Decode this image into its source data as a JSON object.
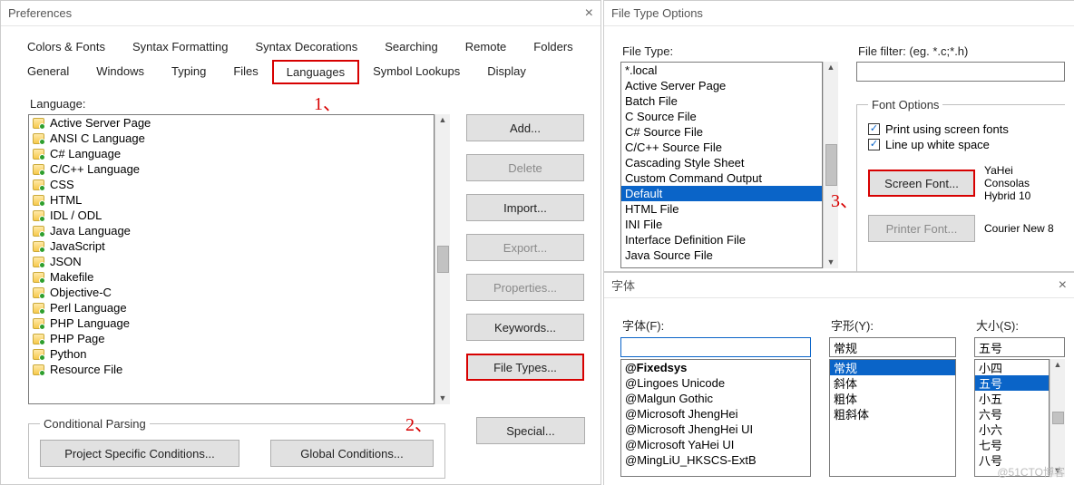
{
  "prefs": {
    "title": "Preferences",
    "tabs_row1": [
      "Colors & Fonts",
      "Syntax Formatting",
      "Syntax Decorations",
      "Searching",
      "Remote",
      "Folders"
    ],
    "tabs_row2": [
      "General",
      "Windows",
      "Typing",
      "Files",
      "Languages",
      "Symbol Lookups",
      "Display"
    ],
    "selected_tab": "Languages",
    "language_label": "Language:",
    "languages": [
      "Active Server Page",
      "ANSI C Language",
      "C# Language",
      "C/C++ Language",
      "CSS",
      "HTML",
      "IDL / ODL",
      "Java Language",
      "JavaScript",
      "JSON",
      "Makefile",
      "Objective-C",
      "Perl Language",
      "PHP Language",
      "PHP Page",
      "Python",
      "Resource File"
    ],
    "buttons": {
      "add": "Add...",
      "delete": "Delete",
      "import": "Import...",
      "export": "Export...",
      "properties": "Properties...",
      "keywords": "Keywords...",
      "filetypes": "File Types...",
      "special": "Special..."
    },
    "cond_legend": "Conditional Parsing",
    "proj_cond": "Project Specific Conditions...",
    "glob_cond": "Global Conditions..."
  },
  "fto": {
    "title": "File Type Options",
    "filetype_label": "File Type:",
    "filefilter_label": "File filter: (eg. *.c;*.h)",
    "file_types": [
      "*.local",
      "Active Server Page",
      "Batch File",
      "C Source File",
      "C# Source File",
      "C/C++ Source File",
      "Cascading Style Sheet",
      "Custom Command Output",
      "Default",
      "HTML File",
      "INI File",
      "Interface Definition File",
      "Java Source File"
    ],
    "selected_file_type": "Default",
    "font_legend": "Font Options",
    "chk1": "Print using screen fonts",
    "chk2": "Line up white space",
    "screen_font_btn": "Screen Font...",
    "printer_font_btn": "Printer Font...",
    "screen_font_desc": "YaHei Consolas Hybrid 10",
    "printer_font_desc": "Courier New 8"
  },
  "fontdlg": {
    "title": "字体",
    "font_label": "字体(F):",
    "style_label": "字形(Y):",
    "size_label": "大小(S):",
    "font_value": "",
    "style_value": "常规",
    "size_value": "五号",
    "fonts": [
      "@Fixedsys",
      "@Lingoes Unicode",
      "@Malgun Gothic",
      "@Microsoft JhengHei",
      "@Microsoft JhengHei UI",
      "@Microsoft YaHei UI",
      "@MingLiU_HKSCS-ExtB"
    ],
    "styles": [
      "常规",
      "斜体",
      "粗体",
      "粗斜体"
    ],
    "selected_style": "常规",
    "sizes": [
      "小四",
      "五号",
      "小五",
      "六号",
      "小六",
      "七号",
      "八号"
    ],
    "selected_size": "五号"
  },
  "annots": {
    "a1": "1、",
    "a2": "2、",
    "a3": "3、"
  },
  "watermark": "@51CTO博客"
}
